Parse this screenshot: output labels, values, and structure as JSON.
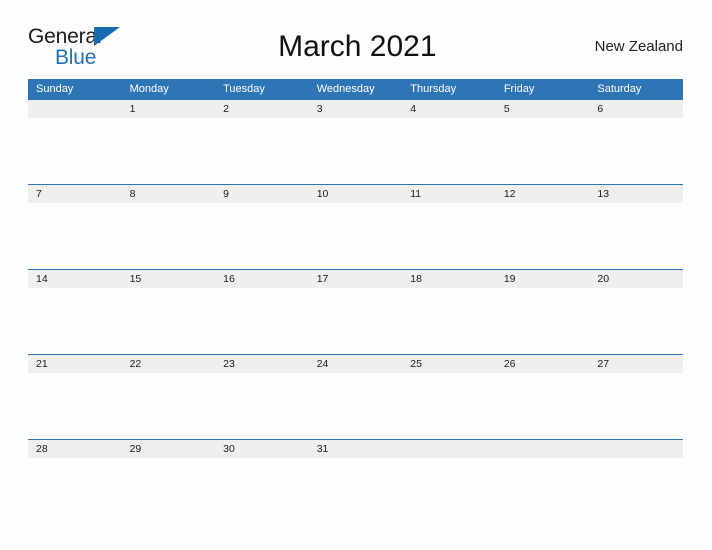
{
  "brand": {
    "name_line1": "General",
    "name_line2": "Blue",
    "accent_color": "#176bb0"
  },
  "header": {
    "title": "March 2021",
    "location": "New Zealand"
  },
  "calendar": {
    "header_bg": "#2e75b6",
    "date_band_bg": "#efeff0",
    "weekday_headers": [
      "Sunday",
      "Monday",
      "Tuesday",
      "Wednesday",
      "Thursday",
      "Friday",
      "Saturday"
    ],
    "weeks": [
      [
        "",
        "1",
        "2",
        "3",
        "4",
        "5",
        "6"
      ],
      [
        "7",
        "8",
        "9",
        "10",
        "11",
        "12",
        "13"
      ],
      [
        "14",
        "15",
        "16",
        "17",
        "18",
        "19",
        "20"
      ],
      [
        "21",
        "22",
        "23",
        "24",
        "25",
        "26",
        "27"
      ],
      [
        "28",
        "29",
        "30",
        "31",
        "",
        "",
        ""
      ]
    ]
  }
}
